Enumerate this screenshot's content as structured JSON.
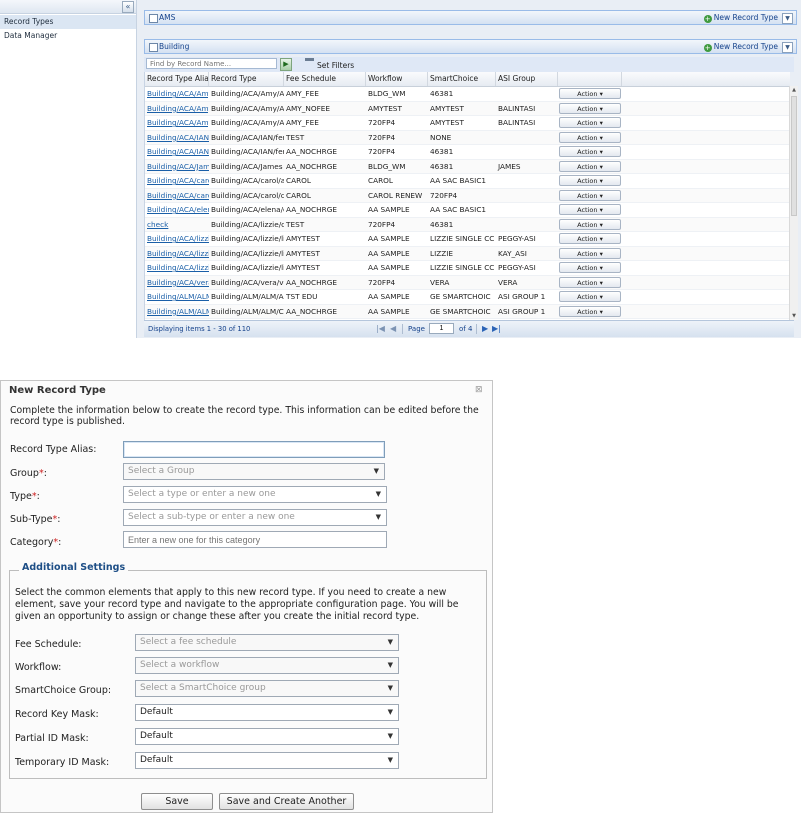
{
  "nav": {
    "collapse_glyph": "«",
    "items": [
      {
        "label": "Record Types",
        "active": true
      },
      {
        "label": "Data Manager",
        "active": false
      }
    ]
  },
  "ams_panel": {
    "title": "AMS",
    "new_record_type": "New Record Type"
  },
  "building_panel": {
    "title": "Building",
    "new_record_type": "New Record Type"
  },
  "toolbar": {
    "search_placeholder": "Find by Record Name...",
    "go_glyph": "▶",
    "set_filters": "Set Filters"
  },
  "grid": {
    "columns": [
      "Record Type Alias",
      "Record Type",
      "Fee Schedule",
      "Workflow",
      "SmartChoice",
      "ASI Group",
      ""
    ],
    "action_label": "Action ▾",
    "rows": [
      {
        "alias": "Building/ACA/Amy/A",
        "type": "Building/ACA/Amy/A",
        "fee": "AMY_FEE",
        "workflow": "BLDG_WM",
        "smartchoice": "46381",
        "asi": ""
      },
      {
        "alias": "Building/ACA/Amy/A",
        "type": "Building/ACA/Amy/A",
        "fee": "AMY_NOFEE",
        "workflow": "AMYTEST",
        "smartchoice": "AMYTEST",
        "asi": "BALINTASI"
      },
      {
        "alias": "Building/ACA/Amy/A",
        "type": "Building/ACA/Amy/A",
        "fee": "AMY_FEE",
        "workflow": "720FP4",
        "smartchoice": "AMYTEST",
        "asi": "BALINTASI"
      },
      {
        "alias": "Building/ACA/IAN/f",
        "type": "Building/ACA/IAN/fer",
        "fee": "TEST",
        "workflow": "720FP4",
        "smartchoice": "NONE",
        "asi": ""
      },
      {
        "alias": "Building/ACA/IAN/f",
        "type": "Building/ACA/IAN/fer",
        "fee": "AA_NOCHRGE",
        "workflow": "720FP4",
        "smartchoice": "46381",
        "asi": ""
      },
      {
        "alias": "Building/ACA/Jam",
        "type": "Building/ACA/James",
        "fee": "AA_NOCHRGE",
        "workflow": "BLDG_WM",
        "smartchoice": "46381",
        "asi": "JAMES"
      },
      {
        "alias": "Building/ACA/carol",
        "type": "Building/ACA/carol/a",
        "fee": "CAROL",
        "workflow": "CAROL",
        "smartchoice": "AA SAC BASIC1",
        "asi": ""
      },
      {
        "alias": "Building/ACA/carol",
        "type": "Building/ACA/carol/c",
        "fee": "CAROL",
        "workflow": "CAROL RENEW",
        "smartchoice": "720FP4",
        "asi": ""
      },
      {
        "alias": "Building/ACA/elen",
        "type": "Building/ACA/elena/e",
        "fee": "AA_NOCHRGE",
        "workflow": "AA SAMPLE",
        "smartchoice": "AA SAC BASIC1",
        "asi": ""
      },
      {
        "alias": "check",
        "type": "Building/ACA/lizzie/c",
        "fee": "TEST",
        "workflow": "720FP4",
        "smartchoice": "46381",
        "asi": ""
      },
      {
        "alias": "Building/ACA/lizzi",
        "type": "Building/ACA/lizzie/li",
        "fee": "AMYTEST",
        "workflow": "AA SAMPLE",
        "smartchoice": "LIZZIE SINGLE CC",
        "asi": "PEGGY-ASI"
      },
      {
        "alias": "Building/ACA/lizzi",
        "type": "Building/ACA/lizzie/li",
        "fee": "AMYTEST",
        "workflow": "AA SAMPLE",
        "smartchoice": "LIZZIE",
        "asi": "KAY_ASI"
      },
      {
        "alias": "Building/ACA/lizzi",
        "type": "Building/ACA/lizzie/li",
        "fee": "AMYTEST",
        "workflow": "AA SAMPLE",
        "smartchoice": "LIZZIE SINGLE CC",
        "asi": "PEGGY-ASI"
      },
      {
        "alias": "Building/ACA/vera",
        "type": "Building/ACA/vera/ve",
        "fee": "AA_NOCHRGE",
        "workflow": "720FP4",
        "smartchoice": "VERA",
        "asi": "VERA"
      },
      {
        "alias": "Building/ALM/ALM",
        "type": "Building/ALM/ALM/A",
        "fee": "TST EDU",
        "workflow": "AA SAMPLE",
        "smartchoice": "GE SMARTCHOIC",
        "asi": "ASI GROUP 1"
      },
      {
        "alias": "Building/ALM/ALM",
        "type": "Building/ALM/ALM/C",
        "fee": "AA_NOCHRGE",
        "workflow": "AA SAMPLE",
        "smartchoice": "GE SMARTCHOIC",
        "asi": "ASI GROUP 1"
      }
    ]
  },
  "pager": {
    "status": "Displaying items 1 - 30 of 110",
    "first_glyph": "|◀",
    "prev_glyph": "◀",
    "page_label": "Page",
    "page_value": "1",
    "of_pages": "of 4",
    "next_glyph": "▶",
    "last_glyph": "▶|"
  },
  "dialog": {
    "title": "New Record Type",
    "close_glyph": "⊠",
    "intro": "Complete the information below to create the record type. This information can be edited before the record type is published.",
    "fields": {
      "alias": {
        "label": "Record Type Alias:",
        "value": ""
      },
      "group": {
        "label": "Group",
        "placeholder": "Select a Group"
      },
      "type": {
        "label": "Type",
        "placeholder": "Select a type or enter a new one"
      },
      "subtype": {
        "label": "Sub-Type",
        "placeholder": "Select a sub-type or enter a new one"
      },
      "category": {
        "label": "Category",
        "placeholder": "Enter a new one for this category"
      }
    },
    "required_mark": "*",
    "label_suffix": ":",
    "additional": {
      "legend": "Additional Settings",
      "description": "Select the common elements that apply to this new record type.  If you need to create a new element,  save your record type and navigate to the appropriate configuration page.  You will be given an opportunity to assign or change these after you create the initial record type.",
      "fields": [
        {
          "label": "Fee Schedule:",
          "value": "Select a fee schedule",
          "filled": false
        },
        {
          "label": "Workflow:",
          "value": "Select a workflow",
          "filled": false
        },
        {
          "label": "SmartChoice Group:",
          "value": "Select a SmartChoice group",
          "filled": false
        },
        {
          "label": "Record Key Mask:",
          "value": "Default",
          "filled": true
        },
        {
          "label": "Partial ID Mask:",
          "value": "Default",
          "filled": true
        },
        {
          "label": "Temporary ID Mask:",
          "value": "Default",
          "filled": true
        }
      ]
    },
    "buttons": {
      "save": "Save",
      "save_another": "Save and Create Another"
    }
  }
}
